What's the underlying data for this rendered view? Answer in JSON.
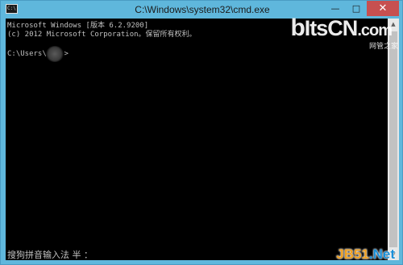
{
  "window": {
    "title": "C:\\Windows\\system32\\cmd.exe",
    "icon_label": "C:\\",
    "controls": {
      "minimize_icon": "—",
      "maximize_icon": "□",
      "close_icon": "✕"
    }
  },
  "console": {
    "lines": [
      "Microsoft Windows [版本 6.2.9200]",
      "(c) 2012 Microsoft Corporation。保留所有权利。",
      "C:\\Users\\    >"
    ],
    "ime_status": "搜狗拼音输入法 半 ："
  },
  "watermarks": {
    "itscn": "ItsCN",
    "itscn_b": "b",
    "itscn_domain": ".com",
    "itscn_sub": "网管之家",
    "jb51_main": "JB51",
    "jb51_net": ".Net"
  },
  "scrollbar": {
    "up_icon": "▲",
    "down_icon": "▼"
  },
  "colors": {
    "frame": "#5fb7dc",
    "console_bg": "#000000",
    "console_text": "#c0c0c0",
    "close_button": "#c75050"
  }
}
